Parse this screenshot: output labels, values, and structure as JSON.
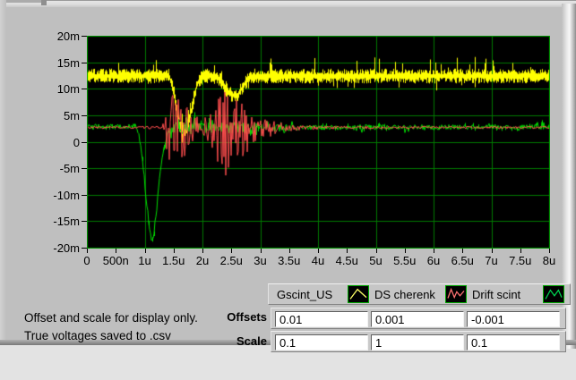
{
  "caption": {
    "line1": "Offset and scale for display only.",
    "line2": "True voltages saved to .csv"
  },
  "offsets": {
    "label": "Offsets",
    "values": [
      "0.01",
      "0.001",
      "-0.001"
    ]
  },
  "scale": {
    "label": "Scale",
    "values": [
      "0.1",
      "1",
      "0.1"
    ]
  },
  "legend": {
    "items": [
      {
        "label": "Gscint_US",
        "color": "#ffff66"
      },
      {
        "label": "DS cherenk",
        "color": "#ff7373"
      },
      {
        "label": "Drift scint",
        "color": "#00d050"
      }
    ]
  },
  "chart_data": {
    "type": "line",
    "title": "",
    "xlabel": "",
    "ylabel": "",
    "x_unit": "seconds",
    "y_unit": "volts",
    "x_ticks": [
      "0",
      "500n",
      "1u",
      "1.5u",
      "2u",
      "2.5u",
      "3u",
      "3.5u",
      "4u",
      "4.5u",
      "5u",
      "5.5u",
      "6u",
      "6.5u",
      "7u",
      "7.5u",
      "8u"
    ],
    "y_ticks": [
      "20m",
      "15m",
      "10m",
      "5m",
      "0",
      "-5m",
      "-10m",
      "-15m",
      "-20m"
    ],
    "x_range_us": [
      0,
      8
    ],
    "y_range_mV": [
      -20,
      20
    ],
    "grid": true,
    "plot_bg": "#000000",
    "grid_color": "#007a00",
    "border_color": "#00a000",
    "legend_position": "bottom-right",
    "series": [
      {
        "name": "Gscint_US",
        "color": "#ffff00",
        "style": "noisy-band",
        "band_halfwidth_mV": 1.1,
        "mean_keypoints_us_mV": [
          [
            0,
            12.4
          ],
          [
            1.42,
            12.4
          ],
          [
            1.5,
            9.5
          ],
          [
            1.58,
            3.5
          ],
          [
            1.66,
            1.8
          ],
          [
            1.74,
            3
          ],
          [
            1.82,
            7
          ],
          [
            1.9,
            11
          ],
          [
            2.0,
            12.3
          ],
          [
            2.15,
            12.5
          ],
          [
            2.3,
            11.8
          ],
          [
            2.4,
            9.8
          ],
          [
            2.5,
            8.8
          ],
          [
            2.6,
            8.8
          ],
          [
            2.7,
            10.5
          ],
          [
            2.8,
            12
          ],
          [
            2.9,
            12.4
          ],
          [
            8,
            12.4
          ]
        ]
      },
      {
        "name": "Drift scint",
        "color": "#00e000",
        "style": "noisy-line",
        "mean_keypoints_us_mV": [
          [
            0,
            2.9
          ],
          [
            0.84,
            2.9
          ],
          [
            0.9,
            1.5
          ],
          [
            0.96,
            -3
          ],
          [
            1.02,
            -10
          ],
          [
            1.08,
            -16
          ],
          [
            1.13,
            -19
          ],
          [
            1.18,
            -16
          ],
          [
            1.24,
            -9
          ],
          [
            1.3,
            -3
          ],
          [
            1.36,
            0.5
          ],
          [
            1.44,
            2.2
          ],
          [
            1.55,
            2.6
          ],
          [
            8,
            2.8
          ]
        ],
        "noise_env_keypoints_us_mV": [
          [
            0,
            0.45
          ],
          [
            0.8,
            0.45
          ],
          [
            1.4,
            0.6
          ],
          [
            1.6,
            1.2
          ],
          [
            1.9,
            1.1
          ],
          [
            2.6,
            1.1
          ],
          [
            3.2,
            0.8
          ],
          [
            3.6,
            0.5
          ],
          [
            8,
            0.45
          ]
        ]
      },
      {
        "name": "DS cherenk",
        "color": "#ff4e4e",
        "style": "oscillation-burst",
        "baseline_mV": 2.7,
        "amp_env_keypoints_us_mV": [
          [
            0,
            0.2
          ],
          [
            1.28,
            0.2
          ],
          [
            1.34,
            1.5
          ],
          [
            1.42,
            5
          ],
          [
            1.5,
            7
          ],
          [
            1.6,
            5.5
          ],
          [
            1.7,
            4.2
          ],
          [
            1.8,
            3
          ],
          [
            1.95,
            1.8
          ],
          [
            2.1,
            2.2
          ],
          [
            2.2,
            4
          ],
          [
            2.3,
            6
          ],
          [
            2.42,
            7.2
          ],
          [
            2.55,
            6
          ],
          [
            2.68,
            4.5
          ],
          [
            2.8,
            3.4
          ],
          [
            2.95,
            2.6
          ],
          [
            3.1,
            1.9
          ],
          [
            3.3,
            1.2
          ],
          [
            3.5,
            0.7
          ],
          [
            3.7,
            0.45
          ],
          [
            3.95,
            0.3
          ],
          [
            4.3,
            0.22
          ],
          [
            8,
            0.2
          ]
        ]
      }
    ]
  }
}
